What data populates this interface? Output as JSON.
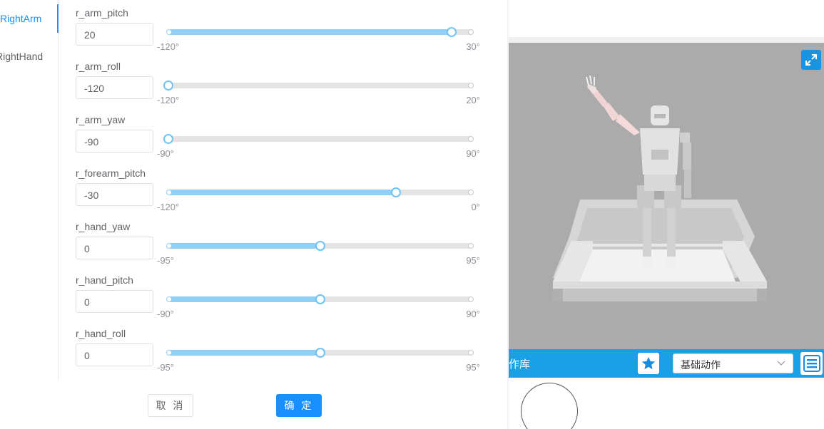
{
  "side_tabs": [
    {
      "label": "RightArm",
      "active": true
    },
    {
      "label": "RightHand",
      "active": false
    }
  ],
  "joints": [
    {
      "label": "r_arm_pitch",
      "value": "20",
      "min": -120,
      "max": 30,
      "min_label": "-120°",
      "max_label": "30°"
    },
    {
      "label": "r_arm_roll",
      "value": "-120",
      "min": -120,
      "max": 20,
      "min_label": "-120°",
      "max_label": "20°"
    },
    {
      "label": "r_arm_yaw",
      "value": "-90",
      "min": -90,
      "max": 90,
      "min_label": "-90°",
      "max_label": "90°"
    },
    {
      "label": "r_forearm_pitch",
      "value": "-30",
      "min": -120,
      "max": 0,
      "min_label": "-120°",
      "max_label": "0°"
    },
    {
      "label": "r_hand_yaw",
      "value": "0",
      "min": -95,
      "max": 95,
      "min_label": "-95°",
      "max_label": "95°"
    },
    {
      "label": "r_hand_pitch",
      "value": "0",
      "min": -90,
      "max": 90,
      "min_label": "-90°",
      "max_label": "90°"
    },
    {
      "label": "r_hand_roll",
      "value": "0",
      "min": -95,
      "max": 95,
      "min_label": "-95°",
      "max_label": "95°"
    }
  ],
  "buttons": {
    "cancel": "取 消",
    "ok": "确 定"
  },
  "action_bar": {
    "title": "作库",
    "select_value": "基础动作",
    "star_icon": "star-icon",
    "menu_icon": "hamburger-menu-icon",
    "fullscreen_icon": "expand-icon"
  },
  "colors": {
    "accent": "#1890ff",
    "slider_fill": "#8fd0f7",
    "action_bar": "#1aa0e8",
    "viewer_bg": "#ababab"
  }
}
